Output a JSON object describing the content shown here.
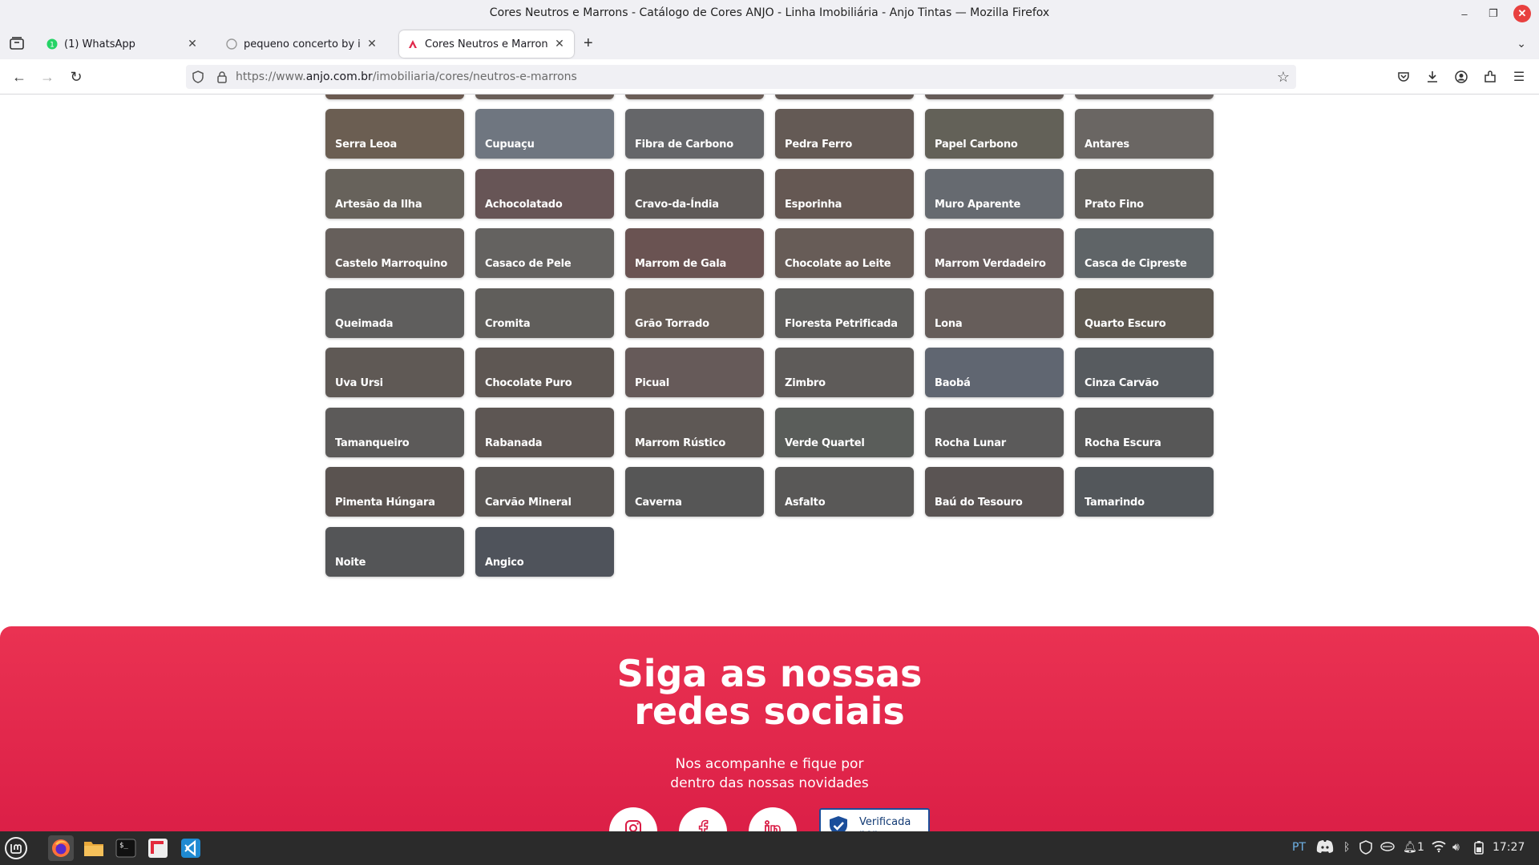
{
  "window": {
    "title": "Cores Neutros e Marrons - Catálogo de Cores ANJO - Linha Imobiliária - Anjo Tintas — Mozilla Firefox"
  },
  "tabs": [
    {
      "label": "(1) WhatsApp",
      "favicon": "whatsapp-icon"
    },
    {
      "label": "pequeno concerto by igorb",
      "favicon": "github-icon"
    },
    {
      "label": "Cores Neutros e Marrons - C",
      "favicon": "anjo-icon"
    }
  ],
  "address": {
    "prefix": "https://www.",
    "domain": "anjo.com.br",
    "path": "/imobiliaria/cores/neutros-e-marrons"
  },
  "swatches": [
    {
      "name": "Serra Leoa",
      "color": "#6b5e52"
    },
    {
      "name": "Cupuaçu",
      "color": "#6f7680"
    },
    {
      "name": "Fibra de Carbono",
      "color": "#656669"
    },
    {
      "name": "Pedra Ferro",
      "color": "#645a55"
    },
    {
      "name": "Papel Carbono",
      "color": "#636158"
    },
    {
      "name": "Antares",
      "color": "#6a6663"
    },
    {
      "name": "Artesão da Ilha",
      "color": "#67625b"
    },
    {
      "name": "Achocolatado",
      "color": "#675556"
    },
    {
      "name": "Cravo-da-Índia",
      "color": "#5f5a58"
    },
    {
      "name": "Esporinha",
      "color": "#655853"
    },
    {
      "name": "Muro Aparente",
      "color": "#666a70"
    },
    {
      "name": "Prato Fino",
      "color": "#625f5b"
    },
    {
      "name": "Castelo Marroquino",
      "color": "#665f5b"
    },
    {
      "name": "Casaco de Pele",
      "color": "#646260"
    },
    {
      "name": "Marrom de Gala",
      "color": "#6a5352"
    },
    {
      "name": "Chocolate ao Leite",
      "color": "#675c57"
    },
    {
      "name": "Marrom Verdadeiro",
      "color": "#685d5c"
    },
    {
      "name": "Casca de Cipreste",
      "color": "#5f6467"
    },
    {
      "name": "Queimada",
      "color": "#5f5e5d"
    },
    {
      "name": "Cromita",
      "color": "#605e5b"
    },
    {
      "name": "Grão Torrado",
      "color": "#665c56"
    },
    {
      "name": "Floresta Petrificada",
      "color": "#5e5d5b"
    },
    {
      "name": "Lona",
      "color": "#665d5a"
    },
    {
      "name": "Quarto Escuro",
      "color": "#5e5850"
    },
    {
      "name": "Uva Ursi",
      "color": "#5f5955"
    },
    {
      "name": "Chocolate Puro",
      "color": "#5e5753"
    },
    {
      "name": "Picual",
      "color": "#665a59"
    },
    {
      "name": "Zimbro",
      "color": "#5e5b59"
    },
    {
      "name": "Baobá",
      "color": "#606671"
    },
    {
      "name": "Cinza Carvão",
      "color": "#575b5f"
    },
    {
      "name": "Tamanqueiro",
      "color": "#5c5a59"
    },
    {
      "name": "Rabanada",
      "color": "#5d5653"
    },
    {
      "name": "Marrom Rústico",
      "color": "#5e5855"
    },
    {
      "name": "Verde Quartel",
      "color": "#5a5d5a"
    },
    {
      "name": "Rocha Lunar",
      "color": "#5b5a5a"
    },
    {
      "name": "Rocha Escura",
      "color": "#575757"
    },
    {
      "name": "Pimenta Húngara",
      "color": "#5a5350"
    },
    {
      "name": "Carvão Mineral",
      "color": "#5a5654"
    },
    {
      "name": "Caverna",
      "color": "#565656"
    },
    {
      "name": "Asfalto",
      "color": "#595857"
    },
    {
      "name": "Baú do Tesouro",
      "color": "#5a5453"
    },
    {
      "name": "Tamarindo",
      "color": "#53575b"
    },
    {
      "name": "Noite",
      "color": "#545557"
    },
    {
      "name": "Angico",
      "color": "#4f535b"
    }
  ],
  "partial_row_colors": [
    "#6b5a50",
    "#6a5f59",
    "#6b5e57",
    "#645a55",
    "#665c58",
    "#6b6562"
  ],
  "social": {
    "title_line1": "Siga as nossas",
    "title_line2": "redes sociais",
    "subtitle_line1": "Nos acompanhe e fique por",
    "subtitle_line2": "dentro das nossas novidades",
    "icons": [
      "instagram-icon",
      "facebook-icon",
      "linkedin-icon"
    ],
    "verified_label": "Verificada por"
  },
  "taskbar": {
    "apps": [
      "mint-menu-icon",
      "firefox-icon",
      "files-icon",
      "terminal-icon",
      "flameshot-icon",
      "vscode-icon"
    ],
    "keyboard_layout": "PT",
    "notification_count": "1",
    "clock": "17:27"
  },
  "colors": {
    "accent": "#e0284b",
    "chrome_bg": "#f0f0f4",
    "taskbar_bg": "#2b2b2b"
  }
}
